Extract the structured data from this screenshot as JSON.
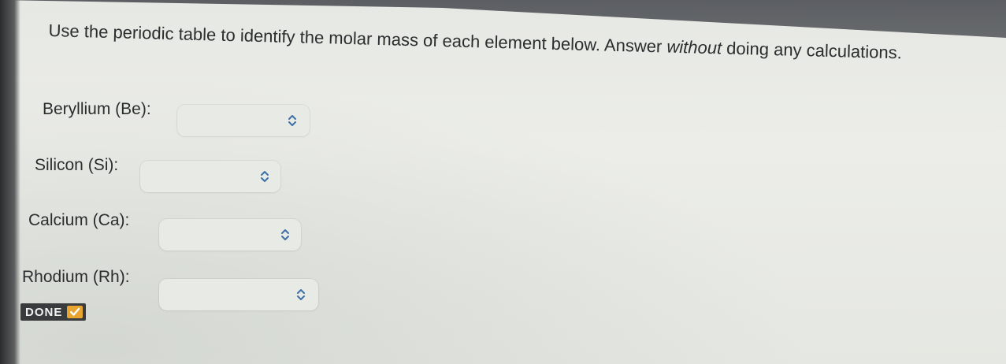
{
  "question": {
    "text_before_italic": "Use the periodic table to identify the molar mass of each element below. Answer ",
    "italic_word": "without",
    "text_after_italic": " doing any calculations."
  },
  "elements": [
    {
      "label": "Beryllium (Be):",
      "selected": ""
    },
    {
      "label": "Silicon (Si):",
      "selected": ""
    },
    {
      "label": "Calcium (Ca):",
      "selected": ""
    },
    {
      "label": "Rhodium (Rh):",
      "selected": ""
    }
  ],
  "done_button": {
    "label": "DONE"
  },
  "colors": {
    "chevron": "#3f6fa6",
    "done_bg": "#3a3b3c",
    "done_check": "#e8a52f"
  },
  "icons": {
    "dropdown": "chevron-up-down-icon",
    "done": "checkmark-icon"
  }
}
